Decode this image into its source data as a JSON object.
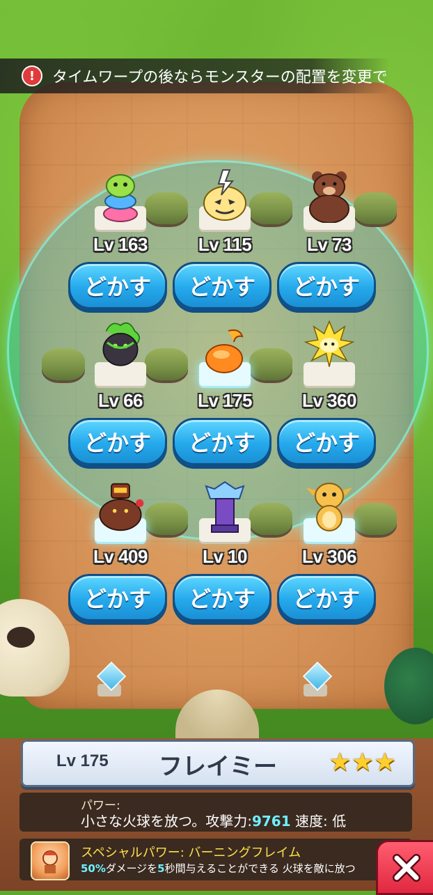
{
  "notice": {
    "text": "タイムワープの後ならモンスターの配置を変更で"
  },
  "slots": [
    {
      "level": "Lv 163",
      "button": "どかす",
      "monster_icon": "stacked-slime-icon"
    },
    {
      "level": "Lv 115",
      "button": "どかす",
      "monster_icon": "thunder-ghost-icon"
    },
    {
      "level": "Lv 73",
      "button": "どかす",
      "monster_icon": "bear-icon"
    },
    {
      "level": "Lv 66",
      "button": "どかす",
      "monster_icon": "vine-golem-icon"
    },
    {
      "level": "Lv 175",
      "button": "どかす",
      "monster_icon": "fire-slime-icon"
    },
    {
      "level": "Lv 360",
      "button": "どかす",
      "monster_icon": "lightning-beast-icon"
    },
    {
      "level": "Lv 409",
      "button": "どかす",
      "monster_icon": "rock-golem-icon"
    },
    {
      "level": "Lv 10",
      "button": "どかす",
      "monster_icon": "crystal-tower-icon"
    },
    {
      "level": "Lv 306",
      "button": "どかす",
      "monster_icon": "baby-dragon-icon"
    }
  ],
  "selected": {
    "level": "Lv 175",
    "name": "フレイミー",
    "stars": 3,
    "power_label": "パワー:",
    "power_desc_prefix": "小さな火球を放つ。攻撃力:",
    "attack": "9761",
    "power_desc_suffix": " 速度: 低",
    "special_title": "スペシャルパワー: バーニングフレイム",
    "special_pct": "50%",
    "special_text_1": "ダメージを",
    "special_seconds": "5",
    "special_text_2": "秒間与えることができる 火球を敵に放つ"
  },
  "colors": {
    "button_blue": "#25a9ec",
    "star_gold": "#ffcf2b",
    "close_red": "#e02840",
    "highlight_cyan": "#6ef0ff"
  }
}
